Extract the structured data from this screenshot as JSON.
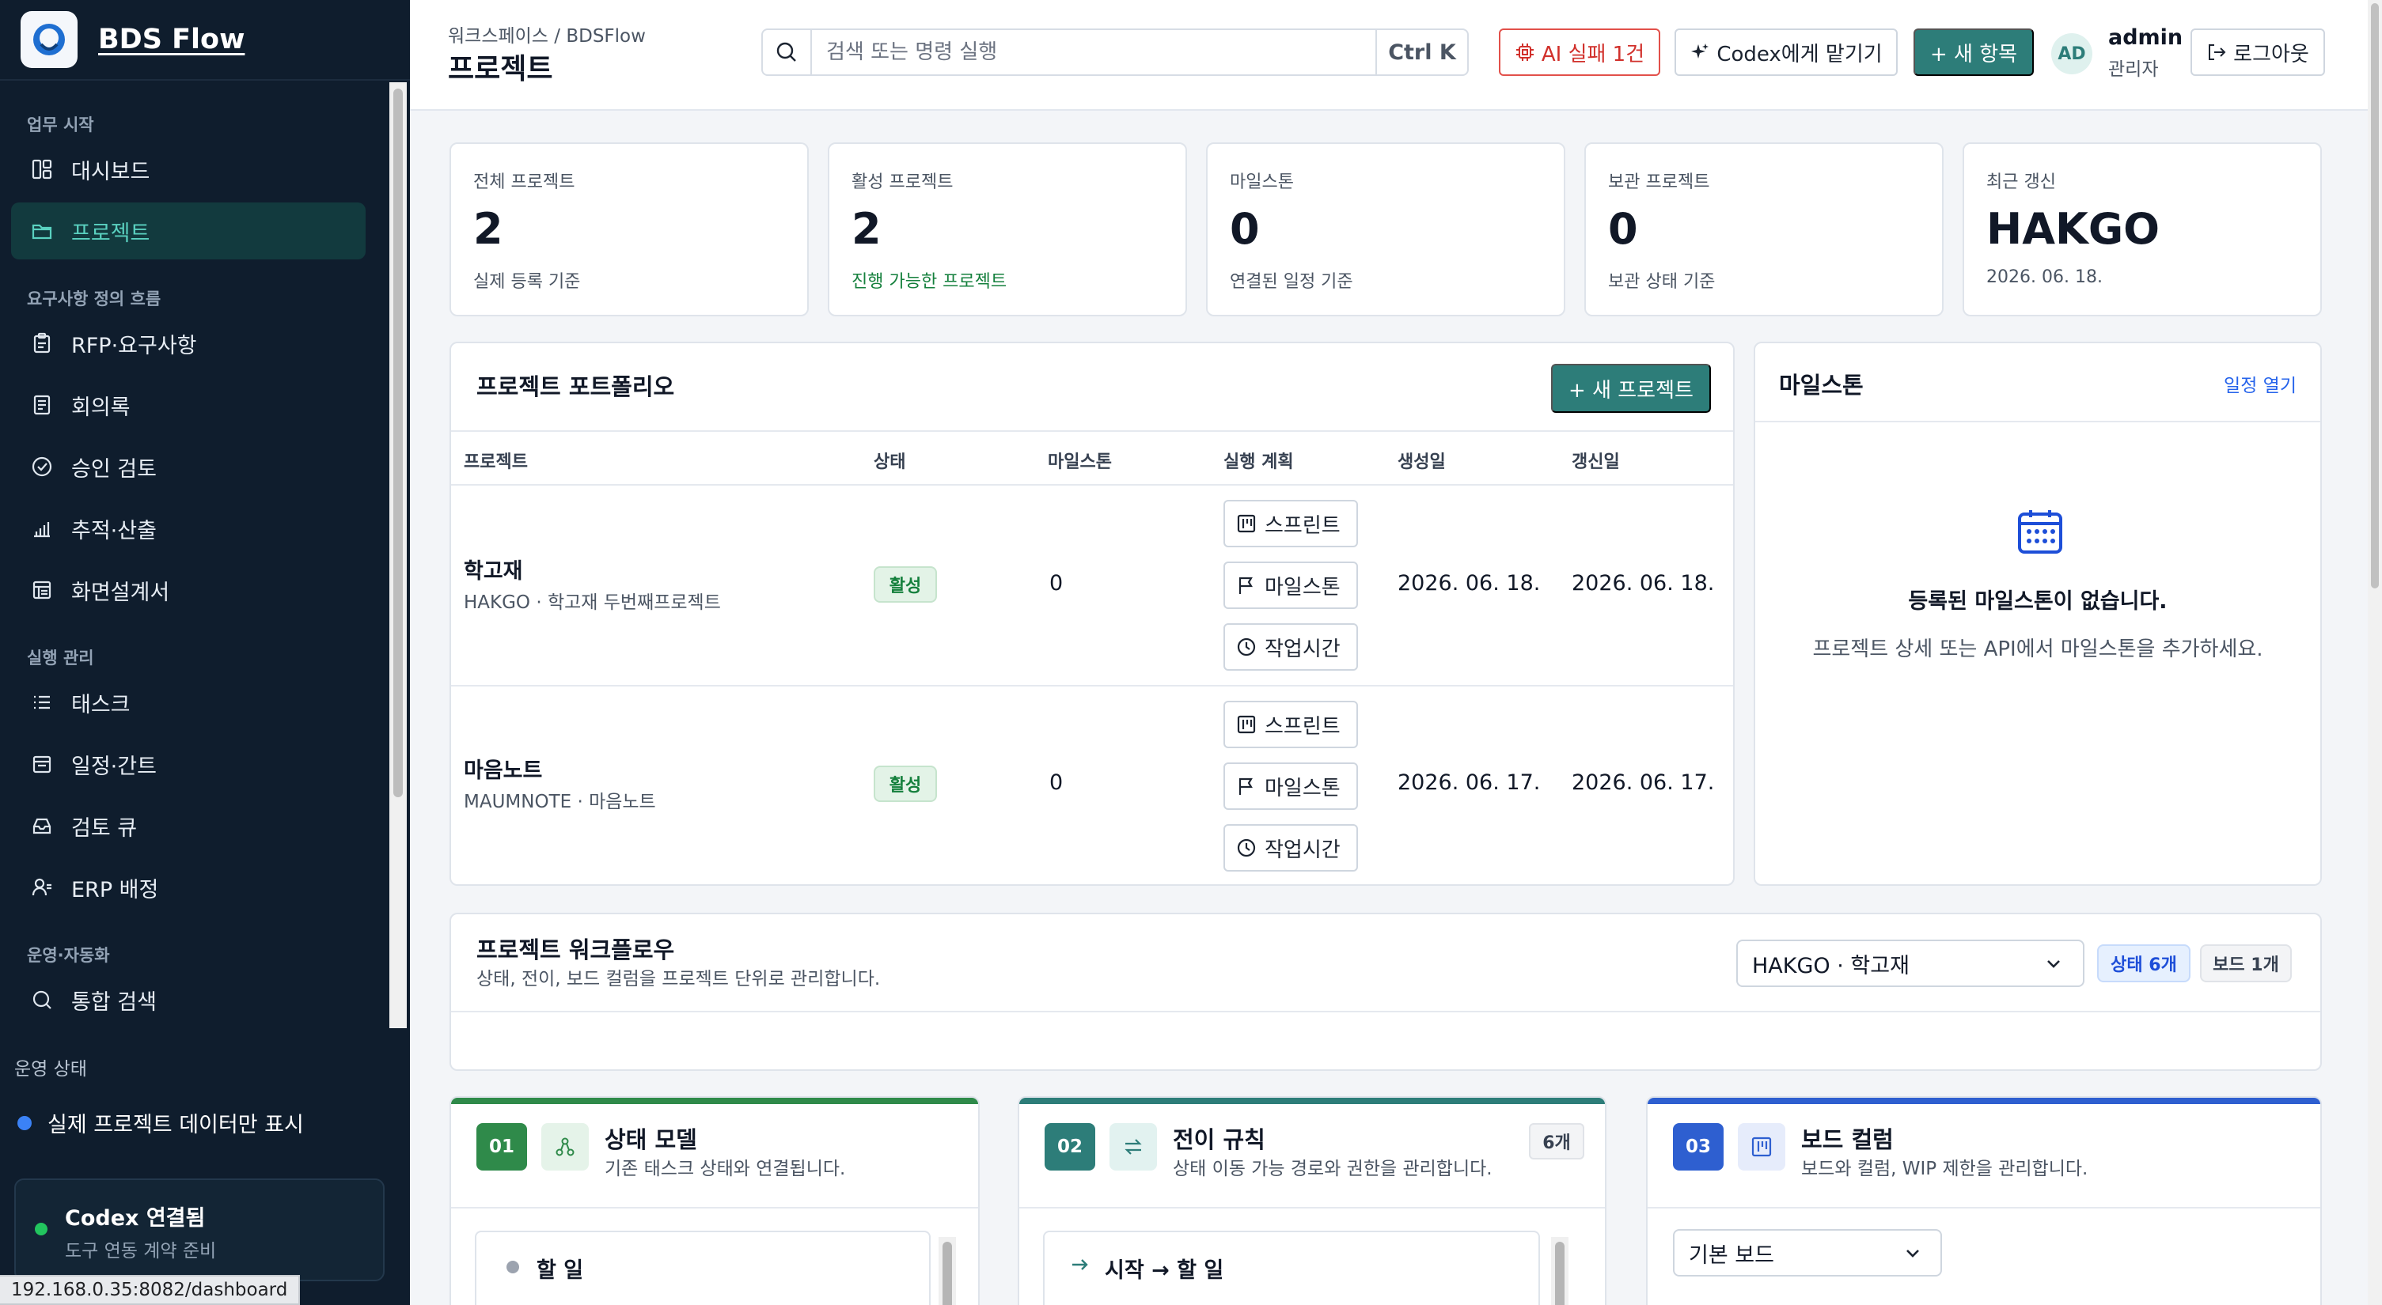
{
  "app": {
    "name": "BDS Flow"
  },
  "sidebar": {
    "sections": [
      {
        "title": "업무 시작",
        "items": [
          {
            "label": "대시보드",
            "icon": "dashboard-icon"
          },
          {
            "label": "프로젝트",
            "icon": "folder-icon",
            "active": true
          }
        ]
      },
      {
        "title": "요구사항 정의 흐름",
        "items": [
          {
            "label": "RFP·요구사항",
            "icon": "clipboard-icon"
          },
          {
            "label": "회의록",
            "icon": "document-icon"
          },
          {
            "label": "승인 검토",
            "icon": "check-circle-icon"
          },
          {
            "label": "추적·산출",
            "icon": "bar-chart-icon"
          },
          {
            "label": "화면설계서",
            "icon": "layout-icon"
          }
        ]
      },
      {
        "title": "실행 관리",
        "items": [
          {
            "label": "태스크",
            "icon": "list-icon"
          },
          {
            "label": "일정·간트",
            "icon": "calendar-icon"
          },
          {
            "label": "검토 큐",
            "icon": "inbox-icon"
          },
          {
            "label": "ERP 배정",
            "icon": "user-assign-icon"
          }
        ]
      },
      {
        "title": "운영·자동화",
        "items": [
          {
            "label": "통합 검색",
            "icon": "search-icon"
          }
        ]
      }
    ],
    "ops_title": "운영 상태",
    "ops_line": "실제 프로젝트 데이터만 표시",
    "codex_status": {
      "title": "Codex 연결됨",
      "subtitle": "도구 연동 계약 준비"
    }
  },
  "statusbar_url": "192.168.0.35:8082/dashboard",
  "topbar": {
    "breadcrumb": "워크스페이스 / BDSFlow",
    "title": "프로젝트",
    "search_placeholder": "검색 또는 명령 실행",
    "search_shortcut": "Ctrl K",
    "ai_fail_label": "AI 실패 1건",
    "codex_label": "Codex에게 맡기기",
    "new_item_label": "+ 새 항목",
    "user": {
      "initials": "AD",
      "name": "admin",
      "role": "관리자"
    },
    "logout_label": "로그아웃"
  },
  "stats": [
    {
      "label": "전체 프로젝트",
      "value": "2",
      "sub": "실제 등록 기준"
    },
    {
      "label": "활성 프로젝트",
      "value": "2",
      "sub": "진행 가능한 프로젝트"
    },
    {
      "label": "마일스톤",
      "value": "0",
      "sub": "연결된 일정 기준"
    },
    {
      "label": "보관 프로젝트",
      "value": "0",
      "sub": "보관 상태 기준"
    },
    {
      "label": "최근 갱신",
      "value": "HAKGO",
      "sub": "2026. 06. 18."
    }
  ],
  "portfolio": {
    "title": "프로젝트 포트폴리오",
    "new_button": "+ 새 프로젝트",
    "columns": [
      "프로젝트",
      "상태",
      "마일스톤",
      "실행 계획",
      "생성일",
      "갱신일"
    ],
    "plan_buttons": [
      "스프린트",
      "마일스톤",
      "작업시간"
    ],
    "rows": [
      {
        "name": "학고재",
        "code": "HAKGO · 학고재 두번째프로젝트",
        "status": "활성",
        "milestones": "0",
        "created": "2026. 06. 18.",
        "updated": "2026. 06. 18."
      },
      {
        "name": "마음노트",
        "code": "MAUMNOTE · 마음노트",
        "status": "활성",
        "milestones": "0",
        "created": "2026. 06. 17.",
        "updated": "2026. 06. 17."
      }
    ]
  },
  "milestone_panel": {
    "title": "마일스톤",
    "link": "일정 열기",
    "empty_title": "등록된 마일스톤이 없습니다.",
    "empty_desc": "프로젝트 상세 또는 API에서 마일스톤을 추가하세요."
  },
  "workflow": {
    "title": "프로젝트 워크플로우",
    "desc": "상태, 전이, 보드 컬럼을 프로젝트 단위로 관리합니다.",
    "selected_project": "HAKGO · 학고재",
    "state_count": "상태 6개",
    "board_count": "보드 1개"
  },
  "config_cards": [
    {
      "num": "01",
      "title": "상태 모델",
      "desc": "기존 태스크 상태와 연결됩니다.",
      "first_item": "할 일",
      "accent": "#2f8a4a"
    },
    {
      "num": "02",
      "title": "전이 규칙",
      "desc": "상태 이동 가능 경로와 권한을 관리합니다.",
      "count": "6개",
      "first_item": "시작 → 할 일",
      "accent": "#2d7d79"
    },
    {
      "num": "03",
      "title": "보드 컬럼",
      "desc": "보드와 컬럼, WIP 제한을 관리합니다.",
      "board_select": "기본 보드",
      "accent": "#2e5fd0"
    }
  ],
  "colors": {
    "sidebar_bg": "#0f1d2d",
    "primary": "#2d7d79",
    "danger": "#d1302b",
    "link": "#2563eb",
    "success": "#15803d"
  }
}
